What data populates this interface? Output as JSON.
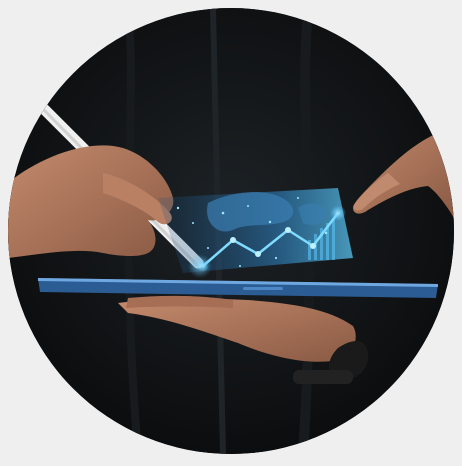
{
  "image": {
    "subject": "hands-holding-tablet-with-holographic-chart",
    "background_color": "#efefef",
    "shirt_color": "#14171a",
    "accent_glow": "#4fc3ff",
    "skin_tone": "#b07a60",
    "tablet_edge": "#3f7fc0",
    "stylus_color": "#f2f2f2",
    "watch_color": "#1a1a1a"
  }
}
